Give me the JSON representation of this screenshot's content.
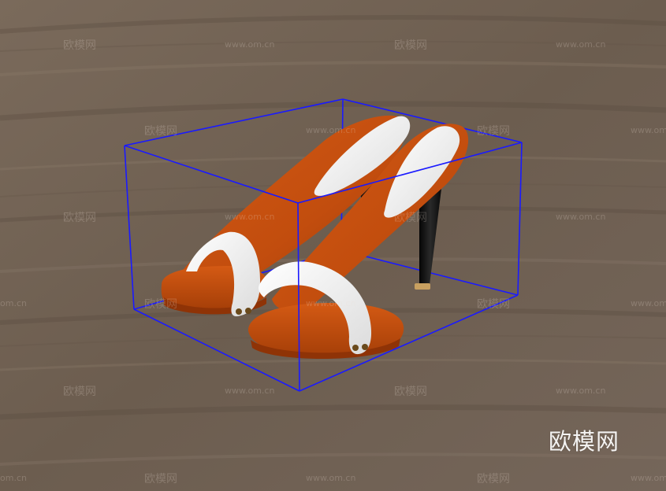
{
  "scene": {
    "subject": "pair-of-orange-high-heel-mule-sandals",
    "colors": {
      "floor": "#6f6052",
      "floor_dark": "#5c4f43",
      "floor_light": "#8b7b6b",
      "shoe_orange": "#c8510f",
      "shoe_orange_dark": "#8f3306",
      "strap_white": "#f4f4f4",
      "heel_black": "#141414",
      "bounding_box": "#1a1aff",
      "rivet": "#6a4a1c"
    }
  },
  "watermark": {
    "brand": "欧模网",
    "url": "www.om.cn",
    "partial_url": "om.cn"
  },
  "logo": {
    "text": "欧模网"
  }
}
